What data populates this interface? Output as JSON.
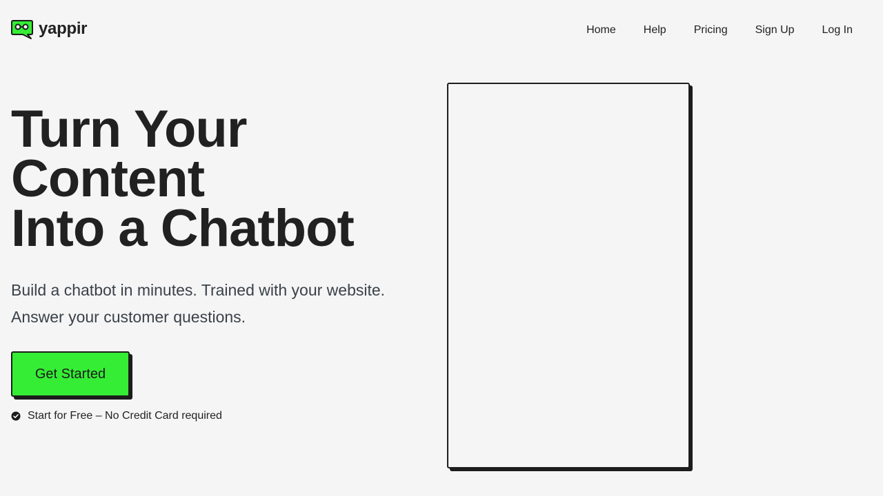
{
  "brand": {
    "name": "yappir",
    "logo_icon": "chat-bubble-eyes-icon",
    "accent": "#35ed35"
  },
  "nav": {
    "items": [
      {
        "label": "Home"
      },
      {
        "label": "Help"
      },
      {
        "label": "Pricing"
      },
      {
        "label": "Sign Up"
      },
      {
        "label": "Log In"
      }
    ]
  },
  "hero": {
    "title_lines": [
      "Turn Your",
      "Content",
      "Into a Chatbot"
    ],
    "subtitle_lines": [
      "Build a chatbot in minutes. Trained with your website.",
      "Answer your customer questions."
    ],
    "cta_label": "Get Started",
    "note": "Start for Free – No Credit Card required",
    "note_icon": "check-circle-icon"
  },
  "chat_preview": {
    "empty": true
  }
}
